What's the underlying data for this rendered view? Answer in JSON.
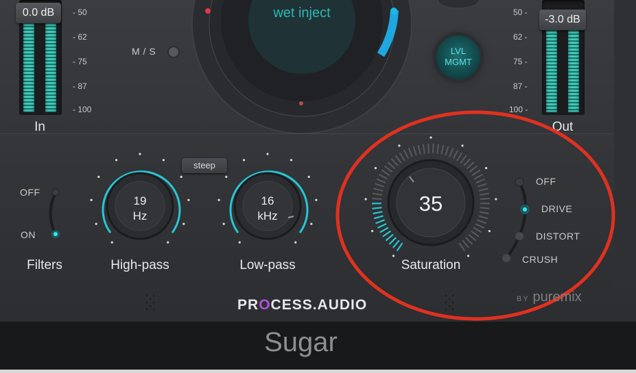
{
  "input": {
    "readout": "0.0 dB",
    "label": "In",
    "scale": [
      "- 50",
      "- 62",
      "- 75",
      "- 87",
      "- 100"
    ]
  },
  "output": {
    "readout": "-3.0 dB",
    "label": "Out",
    "scale": [
      "50 -",
      "62 -",
      "75 -",
      "87 -",
      "100 -"
    ]
  },
  "ms_label": "M / S",
  "wet_inject": "wet inject",
  "lvl_mgmt": [
    "LVL",
    "MGMT"
  ],
  "filters": {
    "label": "Filters",
    "off": "OFF",
    "on": "ON",
    "state": "ON"
  },
  "steep_label": "steep",
  "highpass": {
    "value": "19",
    "unit": "Hz",
    "label": "High-pass"
  },
  "lowpass": {
    "value": "16",
    "unit": "kHz",
    "label": "Low-pass"
  },
  "saturation": {
    "value": "35",
    "label": "Saturation",
    "level": 0.35,
    "modes": [
      "OFF",
      "DRIVE",
      "DISTORT",
      "CRUSH"
    ],
    "selected_mode": "DRIVE"
  },
  "brand": {
    "pre": "PR",
    "o": "O",
    "post": "CESS.AUDIO"
  },
  "byline": {
    "by": "BY",
    "name": "puremix"
  },
  "window_title": "Sugar",
  "colors": {
    "accent": "#27c6d6",
    "meter": "#3fc9b8",
    "annotation": "#e0311f"
  }
}
